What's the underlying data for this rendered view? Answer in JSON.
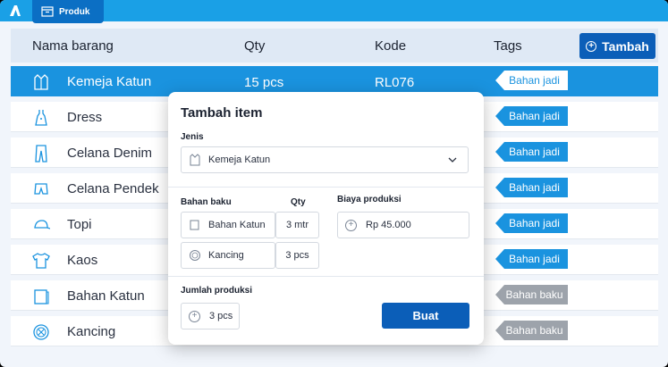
{
  "nav": {
    "tab_label": "Produk"
  },
  "table": {
    "headers": {
      "name": "Nama barang",
      "qty": "Qty",
      "code": "Kode",
      "tags": "Tags"
    },
    "add_button": "Tambah",
    "rows": [
      {
        "name": "Kemeja Katun",
        "qty": "15 pcs",
        "code": "RL076",
        "tag": "Bahan jadi",
        "icon": "shirt-icon"
      },
      {
        "name": "Dress",
        "tag": "Bahan jadi",
        "icon": "dress-icon"
      },
      {
        "name": "Celana Denim",
        "tag": "Bahan jadi",
        "icon": "pants-icon"
      },
      {
        "name": "Celana Pendek",
        "tag": "Bahan jadi",
        "icon": "shorts-icon"
      },
      {
        "name": "Topi",
        "tag": "Bahan jadi",
        "icon": "cap-icon"
      },
      {
        "name": "Kaos",
        "tag": "Bahan jadi",
        "icon": "tshirt-icon"
      },
      {
        "name": "Bahan Katun",
        "tag": "Bahan baku",
        "icon": "fabric-icon"
      },
      {
        "name": "Kancing",
        "tag": "Bahan baku",
        "icon": "button-icon"
      }
    ]
  },
  "modal": {
    "title": "Tambah item",
    "jenis_label": "Jenis",
    "jenis_value": "Kemeja Katun",
    "bahan_label": "Bahan baku",
    "qty_label": "Qty",
    "materials": [
      {
        "name": "Bahan Katun",
        "qty": "3 mtr"
      },
      {
        "name": "Kancing",
        "qty": "3 pcs"
      }
    ],
    "biaya_label": "Biaya produksi",
    "biaya_value": "Rp 45.000",
    "jumlah_label": "Jumlah produksi",
    "jumlah_value": "3 pcs",
    "submit": "Buat"
  },
  "colors": {
    "primary": "#0b5eb8",
    "accent": "#1a93df",
    "tag_baku": "#9da3ab"
  }
}
